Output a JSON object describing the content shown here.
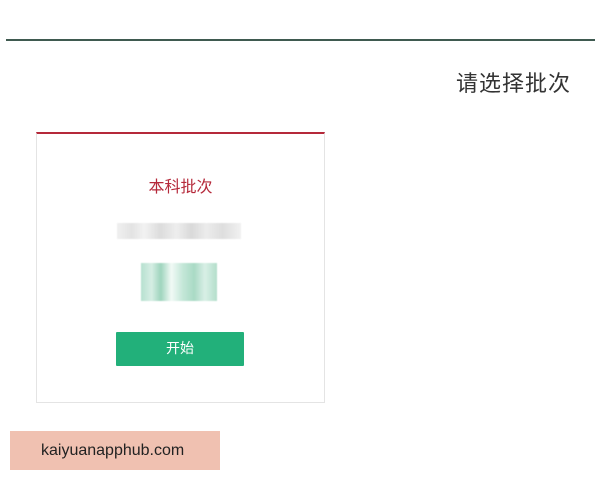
{
  "header": {
    "title": "请选择批次"
  },
  "batch_card": {
    "title": "本科批次",
    "start_label": "开始",
    "accent_color": "#b5293a",
    "button_color": "#22b07a"
  },
  "watermark": {
    "text": "kaiyuanapphub.com"
  }
}
